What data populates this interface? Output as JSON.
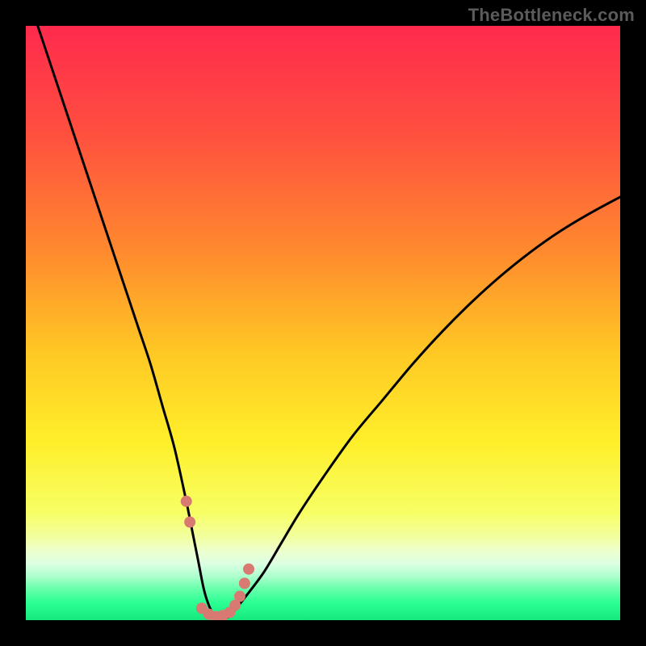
{
  "watermark": "TheBottleneck.com",
  "colors": {
    "bg_black": "#000000",
    "curve": "#000000",
    "marker": "#d97a72",
    "gradient_stops": [
      {
        "offset": 0.0,
        "color": "#ff2a4d"
      },
      {
        "offset": 0.18,
        "color": "#ff4f3f"
      },
      {
        "offset": 0.38,
        "color": "#ff8a2e"
      },
      {
        "offset": 0.55,
        "color": "#ffc824"
      },
      {
        "offset": 0.7,
        "color": "#ffef2a"
      },
      {
        "offset": 0.82,
        "color": "#f7ff65"
      },
      {
        "offset": 0.86,
        "color": "#f2ffa0"
      },
      {
        "offset": 0.885,
        "color": "#ecffd0"
      },
      {
        "offset": 0.905,
        "color": "#dcffe2"
      },
      {
        "offset": 0.925,
        "color": "#b0ffcf"
      },
      {
        "offset": 0.945,
        "color": "#6effae"
      },
      {
        "offset": 0.97,
        "color": "#2cff93"
      },
      {
        "offset": 1.0,
        "color": "#16e87d"
      }
    ]
  },
  "chart_data": {
    "type": "line",
    "title": "",
    "xlabel": "",
    "ylabel": "",
    "xlim": [
      0,
      100
    ],
    "ylim": [
      0,
      100
    ],
    "grid": false,
    "series": [
      {
        "name": "bottleneck-curve",
        "x": [
          1,
          3,
          5,
          7,
          9,
          11,
          13,
          15,
          17,
          19,
          21,
          23,
          25,
          27,
          28,
          29,
          30,
          31,
          32,
          33,
          34,
          35,
          37,
          40,
          43,
          46,
          50,
          55,
          60,
          65,
          70,
          75,
          80,
          85,
          90,
          95,
          100
        ],
        "y": [
          103,
          97,
          91,
          85,
          79,
          73,
          67,
          61,
          55,
          49,
          43,
          36,
          29,
          20,
          15,
          10,
          5,
          2,
          0.5,
          0.2,
          0.5,
          1.5,
          4,
          8,
          13,
          18,
          24,
          31,
          37,
          43,
          48.5,
          53.5,
          58,
          62,
          65.5,
          68.5,
          71.2
        ]
      }
    ],
    "markers": {
      "name": "highlight-dots",
      "x": [
        27.0,
        27.6,
        29.6,
        30.8,
        32.0,
        33.2,
        34.3,
        35.2,
        36.0,
        36.8,
        37.5
      ],
      "y": [
        20.0,
        16.5,
        2.0,
        1.0,
        0.6,
        0.8,
        1.3,
        2.5,
        4.0,
        6.2,
        8.6
      ],
      "size": 14
    }
  }
}
